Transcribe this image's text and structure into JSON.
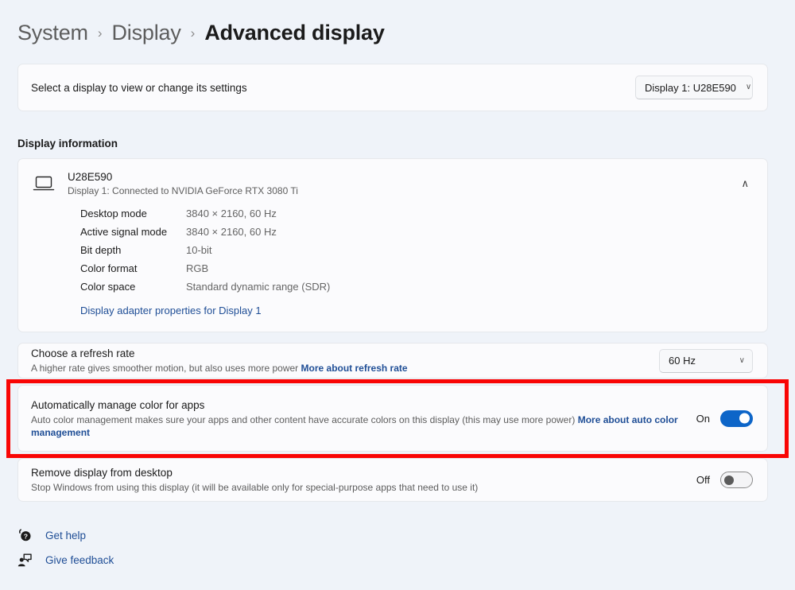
{
  "breadcrumb": {
    "items": [
      "System",
      "Display",
      "Advanced display"
    ],
    "separator": "›"
  },
  "display_selector": {
    "label": "Select a display to view or change its settings",
    "dropdown_value": "Display 1: U28E590",
    "chevron": "∨"
  },
  "display_information": {
    "heading": "Display information",
    "monitor_name": "U28E590",
    "connection": "Display 1: Connected to NVIDIA GeForce RTX 3080 Ti",
    "expand_chevron": "∧",
    "rows": [
      {
        "key": "Desktop mode",
        "value": "3840 × 2160, 60 Hz"
      },
      {
        "key": "Active signal mode",
        "value": "3840 × 2160, 60 Hz"
      },
      {
        "key": "Bit depth",
        "value": "10-bit"
      },
      {
        "key": "Color format",
        "value": "RGB"
      },
      {
        "key": "Color space",
        "value": "Standard dynamic range (SDR)"
      }
    ],
    "adapter_link": "Display adapter properties for Display 1"
  },
  "refresh_rate": {
    "title": "Choose a refresh rate",
    "description": "A higher rate gives smoother motion, but also uses more power",
    "link": "More about refresh rate",
    "dropdown_value": "60 Hz",
    "chevron": "∨"
  },
  "auto_color": {
    "title": "Automatically manage color for apps",
    "description": "Auto color management makes sure your apps and other content have accurate colors on this display (this may use more power)",
    "link": "More about auto color management",
    "toggle_state": "On",
    "toggle_on": true
  },
  "remove_display": {
    "title": "Remove display from desktop",
    "description": "Stop Windows from using this display (it will be available only for special-purpose apps that need to use it)",
    "toggle_state": "Off",
    "toggle_on": false
  },
  "footer": {
    "get_help": "Get help",
    "give_feedback": "Give feedback"
  },
  "colors": {
    "page_background": "#eff3f9",
    "card_background": "#fbfbfd",
    "accent_link": "#1f4e96",
    "toggle_on": "#0d65c8",
    "highlight": "#f90505"
  }
}
